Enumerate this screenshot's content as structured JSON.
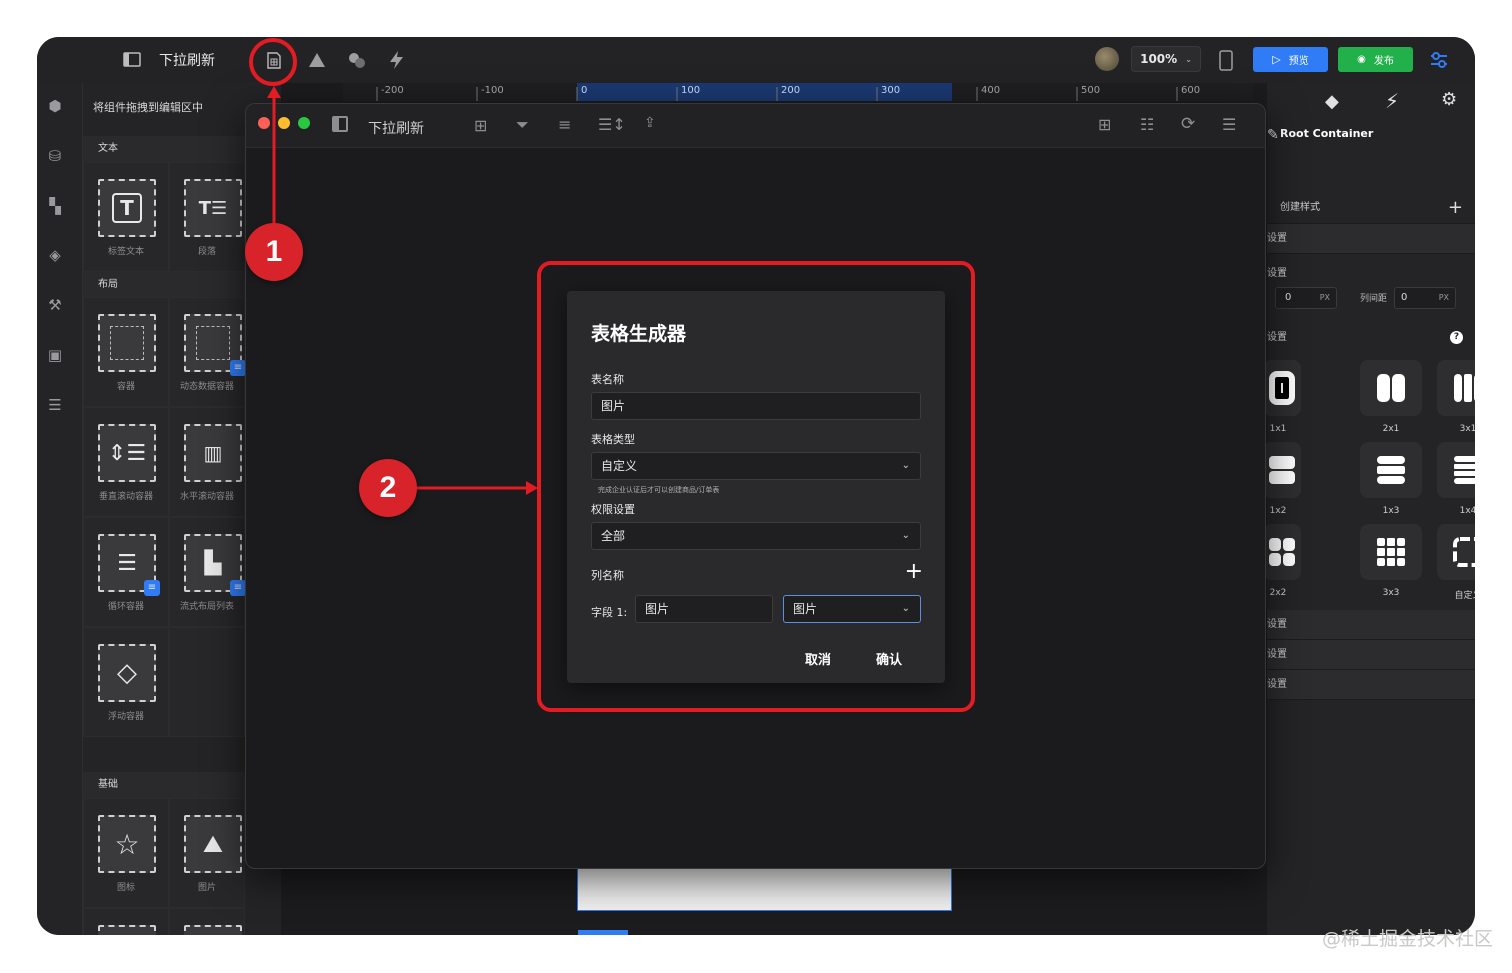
{
  "topbar": {
    "page_name": "下拉刷新",
    "zoom": "100%",
    "preview_label": "预览",
    "publish_label": "发布"
  },
  "ruler": {
    "ticks": [
      "-200",
      "-100",
      "0",
      "100",
      "200",
      "300",
      "400",
      "500",
      "600"
    ]
  },
  "components": {
    "drag_hint": "将组件拖拽到编辑区中",
    "categories": [
      {
        "title": "文本",
        "items": [
          "标签文本",
          "段落"
        ]
      },
      {
        "title": "布局",
        "items": [
          "容器",
          "动态数据容器",
          "垂直滚动容器",
          "水平滚动容器",
          "循环容器",
          "流式布局列表",
          "浮动容器"
        ]
      },
      {
        "title": "基础",
        "items": [
          "图标",
          "图片"
        ]
      }
    ]
  },
  "editor": {
    "title": "下拉刷新"
  },
  "dialog": {
    "title": "表格生成器",
    "table_name_label": "表名称",
    "table_name_value": "图片",
    "table_type_label": "表格类型",
    "table_type_value": "自定义",
    "table_type_hint": "完成企业认证后才可以创建商品/订单表",
    "permission_label": "权限设置",
    "permission_value": "全部",
    "column_name_label": "列名称",
    "field_label": "字段 1:",
    "field_name_value": "图片",
    "field_type_value": "图片",
    "cancel_label": "取消",
    "confirm_label": "确认"
  },
  "right_panel": {
    "root_label": "Root Container",
    "create_style": "创建样式",
    "row_settings_1": "设置",
    "row_settings_2": "设置",
    "px_value_1": "0",
    "px_unit_1": "PX",
    "col_gap_label": "列间距",
    "px_value_2": "0",
    "px_unit_2": "PX",
    "row_settings_3": "设置",
    "help_icon": "?",
    "grid_options": [
      "1x1",
      "2x1",
      "3x1",
      "1x2",
      "1x3",
      "1x4",
      "2x2",
      "3x3",
      "自定义"
    ],
    "bottom_rows": [
      "设置",
      "设置",
      "设置"
    ]
  },
  "annotations": {
    "step1": "1",
    "step2": "2"
  },
  "watermark": "@稀土掘金技术社区",
  "colors": {
    "accent_blue": "#2f7cf6",
    "publish_green": "#22b04a",
    "annotation_red": "#e31b23"
  }
}
